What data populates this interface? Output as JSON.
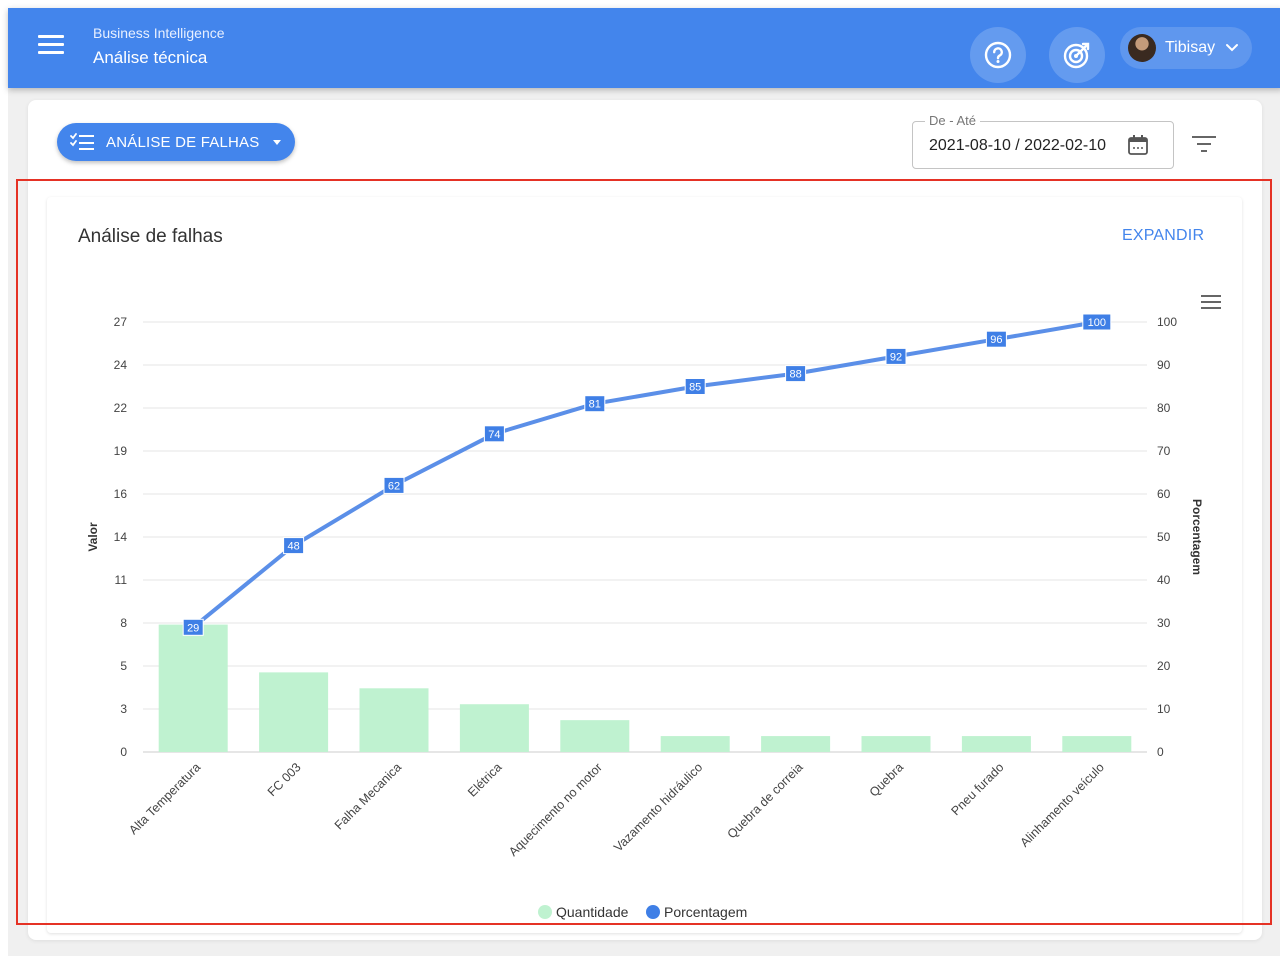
{
  "header": {
    "app_title": "Business Intelligence",
    "page_title": "Análise técnica",
    "user_name": "Tibisay",
    "help_icon": "help-circle-icon",
    "target_icon": "target-icon",
    "accent_color": "#4385ec"
  },
  "toolbar": {
    "analysis_button_label": "ANÁLISE DE FALHAS",
    "date_legend": "De - Até",
    "date_value": "2021-08-10 / 2022-02-10"
  },
  "chart_panel": {
    "title": "Análise de falhas",
    "expand_label": "EXPANDIR"
  },
  "chart_data": {
    "type": "bar",
    "categories": [
      "Alta Temperatura",
      "FC 003",
      "Falha Mecanica",
      "Elétrica",
      "Aquecimento no motor",
      "Vazamento hidráulico",
      "Quebra de correia",
      "Quebra",
      "Pneu furado",
      "Alinhamento veículo"
    ],
    "series": [
      {
        "name": "Quantidade",
        "type": "bar",
        "axis": "left",
        "color": "#bff2d0",
        "values": [
          8,
          5,
          4,
          3,
          2,
          1,
          1,
          1,
          1,
          1
        ]
      },
      {
        "name": "Porcentagem",
        "type": "line",
        "axis": "right",
        "color": "#5b8fe8",
        "values": [
          29,
          48,
          62,
          74,
          81,
          85,
          88,
          92,
          96,
          100
        ]
      }
    ],
    "ylabel": "Valor",
    "ylabel_right": "Porcentagem",
    "yticks_left": [
      "0",
      "3",
      "5",
      "8",
      "11",
      "14",
      "16",
      "19",
      "22",
      "24",
      "27"
    ],
    "yticks_right": [
      "0",
      "10",
      "20",
      "30",
      "40",
      "50",
      "60",
      "70",
      "80",
      "90",
      "100"
    ],
    "ylim_left": [
      0,
      27
    ],
    "ylim_right": [
      0,
      100
    ],
    "grid": true,
    "legend": "bottom-center"
  }
}
